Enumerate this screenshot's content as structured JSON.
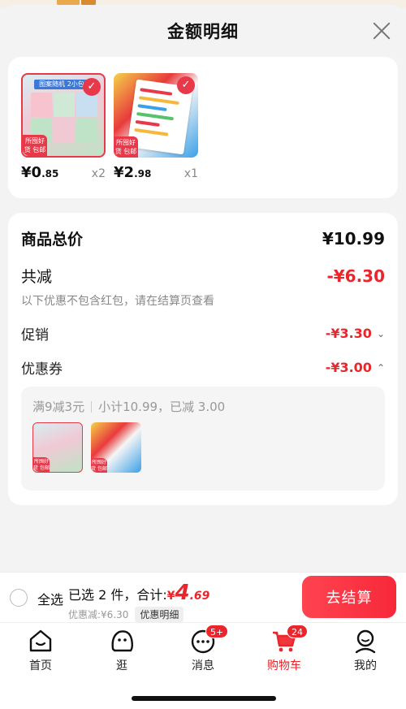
{
  "sheet": {
    "title": "金额明细"
  },
  "products": [
    {
      "price_int": "¥0",
      "price_dec": ".85",
      "qty": "x2",
      "tag": "所囤好货 包邮",
      "band_text": "图案随机  2小包装"
    },
    {
      "price_int": "¥2",
      "price_dec": ".98",
      "qty": "x1",
      "tag": "所囤好货 包邮",
      "band_text": ""
    }
  ],
  "totals": {
    "goods_total_label": "商品总价",
    "goods_total_value": "¥10.99",
    "reduction_label": "共减",
    "reduction_value": "-¥6.30",
    "note": "以下优惠不包含红包，请在结算页查看",
    "promo_label": "促销",
    "promo_value": "-¥3.30",
    "coupon_label": "优惠券",
    "coupon_value": "-¥3.00",
    "coupon_rule": "满9减3元",
    "coupon_summary": "小计10.99，已减 3.00"
  },
  "checkout": {
    "select_all": "全选",
    "selected_text": "已选 2 件，合计:",
    "total_currency": "¥",
    "total_int": "4",
    "total_dec": ".69",
    "discount_text": "优惠减:¥6.30",
    "detail_chip": "优惠明细",
    "button": "去结算"
  },
  "tabs": [
    {
      "label": "首页",
      "icon": "home-icon"
    },
    {
      "label": "逛",
      "icon": "explore-face-icon"
    },
    {
      "label": "消息",
      "icon": "message-icon",
      "badge": "5+"
    },
    {
      "label": "购物车",
      "icon": "cart-icon",
      "badge": "24",
      "active": true
    },
    {
      "label": "我的",
      "icon": "profile-icon"
    }
  ],
  "colors": {
    "accent": "#e8262b",
    "button": "#f7283a"
  }
}
